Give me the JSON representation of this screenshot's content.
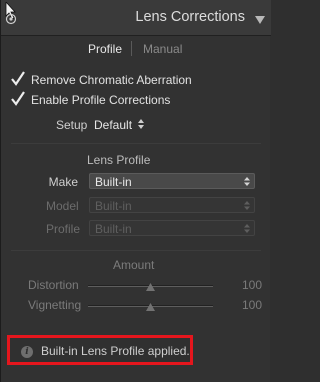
{
  "header": {
    "title": "Lens Corrections"
  },
  "tabs": {
    "profile": "Profile",
    "manual": "Manual"
  },
  "checkboxes": {
    "chromatic": {
      "label": "Remove Chromatic Aberration",
      "checked": true
    },
    "profile_corrections": {
      "label": "Enable Profile Corrections",
      "checked": true
    }
  },
  "setup": {
    "label": "Setup",
    "value": "Default"
  },
  "lens_profile": {
    "title": "Lens Profile",
    "make": {
      "label": "Make",
      "value": "Built-in"
    },
    "model": {
      "label": "Model",
      "value": "Built-in"
    },
    "profile": {
      "label": "Profile",
      "value": "Built-in"
    }
  },
  "amount": {
    "title": "Amount",
    "distortion": {
      "label": "Distortion",
      "value": "100"
    },
    "vignetting": {
      "label": "Vignetting",
      "value": "100"
    }
  },
  "info": {
    "message": "Built-in Lens Profile applied."
  },
  "colors": {
    "highlight_border": "#e5161d",
    "panel_bg": "#323232",
    "header_bg": "#3a3a3a"
  }
}
